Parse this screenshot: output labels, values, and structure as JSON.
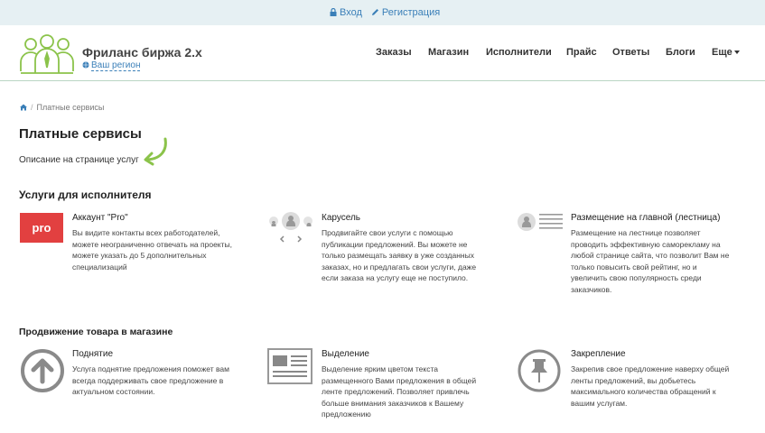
{
  "topbar": {
    "login": "Вход",
    "register": "Регистрация",
    "login_icon": "lock-icon",
    "register_icon": "pencil-icon"
  },
  "brand": {
    "name": "Фриланс биржа 2.x",
    "region": "Ваш регион",
    "logo_icon": "people-group-logo",
    "region_icon": "globe-icon",
    "logo_color": "#8bc34a"
  },
  "nav": {
    "items": [
      "Заказы",
      "Магазин",
      "Исполнители",
      "Прайс",
      "Ответы",
      "Блоги",
      "Еще"
    ]
  },
  "breadcrumb": {
    "home_icon": "home-icon",
    "current": "Платные сервисы"
  },
  "page": {
    "title": "Платные сервисы",
    "description": "Описание на странице услуг",
    "accent": "#8bc34a"
  },
  "section_performer": {
    "heading": "Услуги для исполнителя",
    "cards": [
      {
        "icon": "pro-badge",
        "badge": "pro",
        "title": "Аккаунт \"Pro\"",
        "lines": [
          "Вы видите контакты всех работодателей,",
          "можете неограниченно отвечать на проекты,",
          "можете указать до 5 дополнительных",
          "специализаций"
        ]
      },
      {
        "icon": "carousel-icon",
        "title": "Карусель",
        "lines": [
          "Продвигайте свои услуги с помощью",
          "публикации предложений. Вы можете не",
          "только размещать заявку в уже созданных",
          "заказах, но и предлагать свои услуги, даже",
          "если заказа на услугу еще не поступило."
        ]
      },
      {
        "icon": "ladder-icon",
        "title": "Размещение на главной (лестница)",
        "lines": [
          "Размещение на лестнице позволяет",
          "проводить эффективную саморекламу на",
          "любой странице сайта, что позволит Вам не",
          "только повысить свой рейтинг, но и",
          "увеличить свою популярность среди",
          "заказчиков."
        ]
      }
    ]
  },
  "section_shop": {
    "heading": "Продвижение товара в магазине",
    "cards": [
      {
        "icon": "arrow-up-circle-icon",
        "title": "Поднятие",
        "lines": [
          "Услуга поднятие предложения поможет вам",
          "всегда поддерживать свое предложение в",
          "актуальном состоянии."
        ]
      },
      {
        "icon": "highlight-article-icon",
        "title": "Выделение",
        "lines": [
          "Выделение ярким цветом текста",
          "размещенного Вами предложения в общей",
          "ленте предложений. Позволяет привлечь",
          "больше внимания заказчиков к Вашему",
          "предложению"
        ]
      },
      {
        "icon": "pin-circle-icon",
        "title": "Закрепление",
        "lines": [
          "Закрепив свое предложение наверху общей",
          "ленты предложений, вы добьетесь",
          "максимального количества обращений к",
          "вашим услугам."
        ]
      }
    ]
  }
}
